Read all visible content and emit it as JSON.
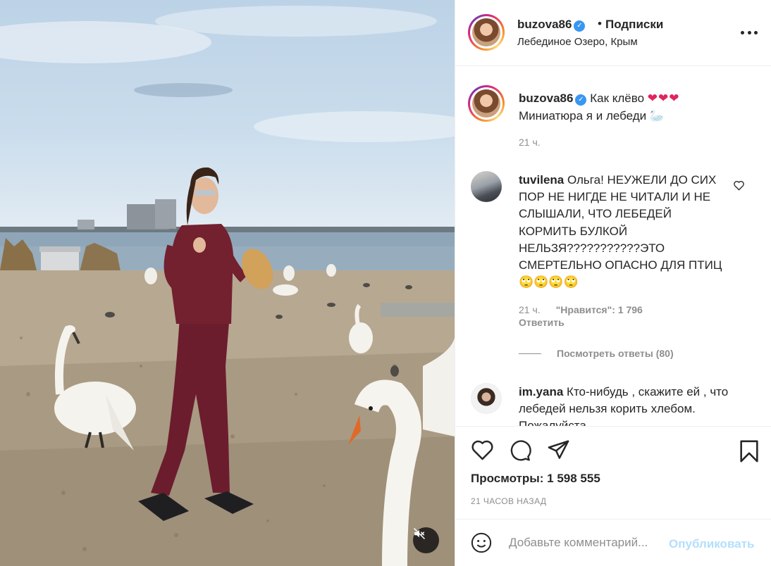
{
  "post": {
    "username": "buzova86",
    "follow_label": "Подписки",
    "location": "Лебединое Озеро, Крым",
    "caption": {
      "username": "buzova86",
      "line1": "Как клёво",
      "hearts": "❤❤❤",
      "line2": "Миниатюра я и лебеди",
      "swan_emoji": "🦢",
      "time": "21 ч."
    },
    "comments": [
      {
        "username": "tuvilena",
        "text": "Ольга! НЕУЖЕЛИ ДО СИХ ПОР НЕ НИГДЕ НЕ ЧИТАЛИ И НЕ СЛЫШАЛИ, ЧТО ЛЕБЕДЕЙ КОРМИТЬ БУЛКОЙ НЕЛЬЗЯ???????????ЭТО СМЕРТЕЛЬНО ОПАСНО ДЛЯ ПТИЦ🙄🙄🙄🙄",
        "time": "21 ч.",
        "likes": "\"Нравится\": 1 796",
        "reply_label": "Ответить",
        "view_replies": "Посмотреть ответы (80)"
      },
      {
        "username": "im.yana",
        "text": "Кто-нибудь , скажите ей , что лебедей нельзя корить хлебом. Пожалуйста"
      }
    ],
    "views": "Просмотры: 1 598 555",
    "posted_ago": "21 часов назад",
    "add_comment_placeholder": "Добавьте комментарий...",
    "publish_label": "Опубликовать"
  },
  "icons": {
    "more": "more-options-icon",
    "like": "heart-icon",
    "comment": "comment-icon",
    "share": "paper-plane-icon",
    "save": "bookmark-icon",
    "emoji": "smiley-icon",
    "mute": "speaker-muted-icon",
    "verified": "verified-badge-icon"
  },
  "colors": {
    "verified": "#3897f0",
    "publish_disabled": "#b2dffc",
    "heart": "#e0245e",
    "secondary_text": "#8e8e8e"
  }
}
